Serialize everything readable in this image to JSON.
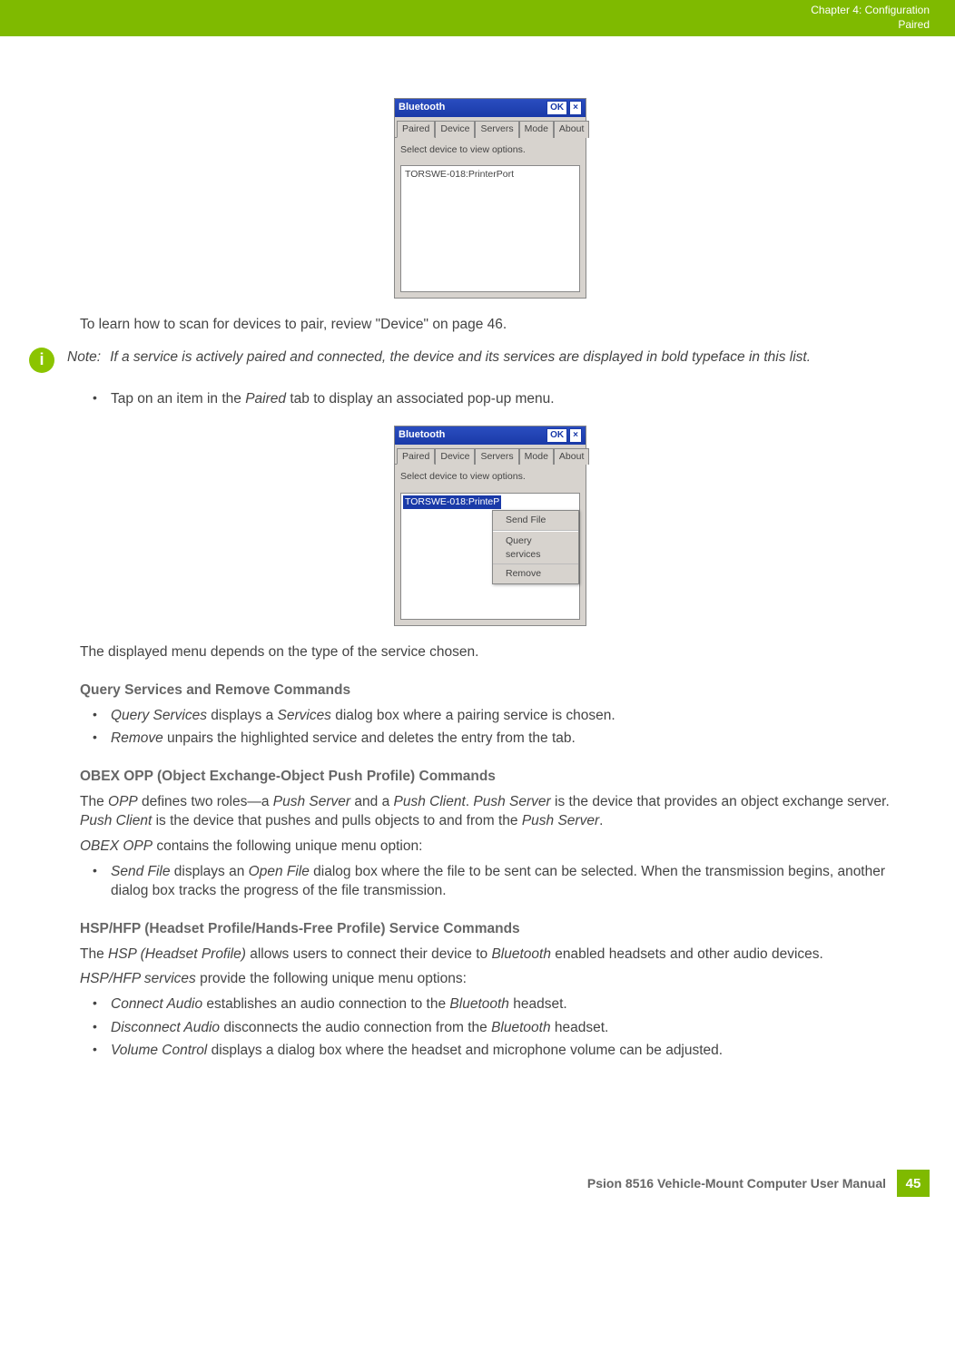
{
  "topbar": {
    "chapter": "Chapter 4:  Configuration",
    "section": "Paired"
  },
  "screenshot1": {
    "title": "Bluetooth",
    "ok": "OK",
    "close": "×",
    "tabs": [
      "Paired",
      "Device",
      "Servers",
      "Mode",
      "About"
    ],
    "instruction": "Select device to view options.",
    "item": "TORSWE-018:PrinterPort"
  },
  "para1": "To learn how to scan for devices to pair, review \"Device\" on page 46.",
  "note": {
    "label": "Note:",
    "text": "If a service is actively paired and connected, the device and its services are displayed in bold typeface in this list."
  },
  "bullet1": {
    "pre": "Tap on an item in the ",
    "em": "Paired",
    "post": " tab to display an associated pop-up menu."
  },
  "screenshot2": {
    "title": "Bluetooth",
    "ok": "OK",
    "close": "×",
    "tabs": [
      "Paired",
      "Device",
      "Servers",
      "Mode",
      "About"
    ],
    "instruction": "Select device to view options.",
    "item": "TORSWE-018:PrinteP",
    "popup": [
      "Send File",
      "Query services",
      "Remove"
    ]
  },
  "para2": "The displayed menu depends on the type of the service chosen.",
  "h1": "Query Services and Remove Commands",
  "qs_li1": {
    "em": "Query Services",
    "post": " displays a ",
    "em2": "Services",
    "post2": " dialog box where a pairing service is chosen."
  },
  "qs_li2": {
    "em": "Remove",
    "post": " unpairs the highlighted service and deletes the entry from the tab."
  },
  "h2": "OBEX OPP (Object Exchange-Object Push Profile) Commands",
  "opp_p1": {
    "pre": "The ",
    "em1": "OPP",
    "mid1": " defines two roles—a ",
    "em2": "Push Server",
    "mid2": " and a ",
    "em3": "Push Client",
    "mid3": ". ",
    "em4": "Push Server",
    "mid4": " is the device that provides an object exchange server. ",
    "em5": "Push Client",
    "mid5": " is the device that pushes and pulls objects to and from the ",
    "em6": "Push Server",
    "post": "."
  },
  "opp_p2": {
    "em": "OBEX OPP",
    "post": " contains the following unique menu option:"
  },
  "opp_li": {
    "em1": "Send File",
    "mid": " displays an ",
    "em2": "Open File",
    "post": " dialog box where the file to be sent can be selected. When the transmission begins, another dialog box tracks the progress of the file transmission."
  },
  "h3": "HSP/HFP (Headset Profile/Hands-Free Profile) Service Commands",
  "hsp_p1": {
    "pre": "The ",
    "em1": "HSP (Headset Profile)",
    "mid": " allows users to connect their device to ",
    "em2": "Bluetooth",
    "post": " enabled headsets and other audio devices."
  },
  "hsp_p2": {
    "em": "HSP/HFP services",
    "post": " provide the following unique menu options:"
  },
  "hsp_li1": {
    "em1": "Connect Audio",
    "mid": " establishes an audio connection to the ",
    "em2": "Bluetooth",
    "post": " headset."
  },
  "hsp_li2": {
    "em1": "Disconnect Audio",
    "mid": " disconnects the audio connection from the ",
    "em2": "Bluetooth",
    "post": " headset."
  },
  "hsp_li3": {
    "em": "Volume Control",
    "post": " displays a dialog box where the headset and microphone volume can be adjusted."
  },
  "footer": {
    "text": "Psion 8516 Vehicle-Mount Computer User Manual",
    "page": "45"
  }
}
